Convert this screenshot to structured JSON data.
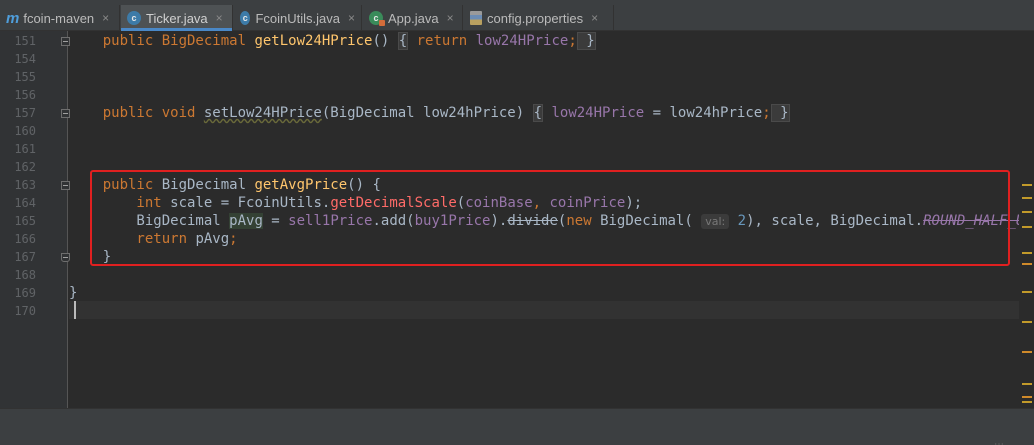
{
  "tabs": [
    {
      "label": "fcoin-maven",
      "icon": "maven-module-icon",
      "active": false
    },
    {
      "label": "Ticker.java",
      "icon": "java-class-icon",
      "active": true
    },
    {
      "label": "FcoinUtils.java",
      "icon": "java-class-icon",
      "active": false
    },
    {
      "label": "App.java",
      "icon": "java-class-icon",
      "active": false
    },
    {
      "label": "config.properties",
      "icon": "properties-file-icon",
      "active": false
    }
  ],
  "close_glyph": "×",
  "icon_letters": {
    "maven": "m",
    "java": "c"
  },
  "line_numbers": [
    "151",
    "154",
    "155",
    "156",
    "157",
    "160",
    "161",
    "162",
    "163",
    "164",
    "165",
    "166",
    "167",
    "168",
    "169",
    "170"
  ],
  "code": {
    "l151": {
      "pre": "    public BigDecimal ",
      "fn": "getLow24HPrice",
      "mid": "() ",
      "b1": "{",
      "kw": " return ",
      "fld": "low24HPrice",
      "semi": ";",
      "b2": " }"
    },
    "l157": {
      "pre": "    public void ",
      "fn": "setLow24HPrice",
      "mid": "(BigDecimal low24hPrice) ",
      "b1": "{",
      "fld": " low24HPrice",
      "rest": " = low24hPrice",
      "semi": ";",
      "b2": " }"
    },
    "l163": {
      "kw1": "    public ",
      "t": "BigDecimal ",
      "fn": "getAvgPrice",
      "rest": "() {"
    },
    "l164": {
      "kw": "        int ",
      "a": "scale = FcoinUtils.",
      "stat": "getDecimalScale",
      "b": "(",
      "f1": "coinBase",
      "c": ", ",
      "f2": "coinPrice",
      "d": ");"
    },
    "l165": {
      "a": "        BigDecimal ",
      "var": "pAvg",
      "b": " = ",
      "f1": "sell1Price",
      "c": ".add(",
      "f2": "buy1Price",
      "d": ").",
      "dep": "divide",
      "e": "(",
      "kw": "new ",
      "f": "BigDecimal( ",
      "hint": "val:",
      "num": " 2",
      "g": "), scale, BigDecimal.",
      "stat": "ROUND_HALF_UP",
      "h": ");"
    },
    "l166": {
      "kw": "        return ",
      "a": "pAvg",
      "semi": ";"
    },
    "l167": {
      "a": "    }"
    },
    "l169": {
      "a": "}"
    }
  },
  "colors": {
    "keyword": "#cc7832",
    "method": "#ffc66d",
    "field": "#9876aa",
    "number": "#6897bb",
    "text": "#a9b7c6",
    "highlight_box": "#e02020"
  }
}
